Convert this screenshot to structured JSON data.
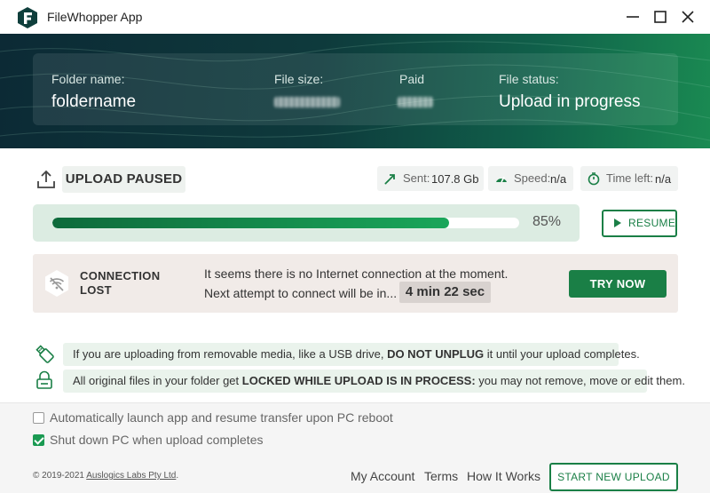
{
  "app": {
    "title": "FileWhopper App",
    "logo_letter": "F",
    "brand_color": "#1a7f46",
    "window_controls": [
      "minimize-icon",
      "maximize-icon",
      "close-icon"
    ]
  },
  "header": {
    "folder_label": "Folder name:",
    "folder_value": "foldername",
    "size_label": "File size:",
    "paid_label": "Paid",
    "status_label": "File status:",
    "status_value": "Upload in progress"
  },
  "status": {
    "icon": "upload-icon",
    "label": "UPLOAD PAUSED",
    "sent_label": "Sent:",
    "sent_value": "107.8 Gb",
    "speed_label": "Speed:",
    "speed_value": "n/a",
    "time_label": "Time left:",
    "time_value": "n/a"
  },
  "progress": {
    "percent": 85,
    "percent_text": "85%",
    "resume_label": "RESUME"
  },
  "connection": {
    "icon": "wifi-off-icon",
    "title_line1": "CONNECTION",
    "title_line2": "LOST",
    "message1": "It seems there is no Internet connection at the moment.",
    "message2": "Next attempt to connect will be in...",
    "countdown": "4 min 22 sec",
    "try_label": "TRY NOW"
  },
  "notices": [
    {
      "icon": "usb-drive-icon",
      "before": "If you are uploading from removable media, like a USB drive, ",
      "bold": "DO NOT UNPLUG",
      "after": " it until your upload completes."
    },
    {
      "icon": "lock-icon",
      "before": "All original files in your folder get ",
      "bold": "LOCKED WHILE UPLOAD IS IN PROCESS:",
      "after": " you may not remove, move or edit them."
    }
  ],
  "options": [
    {
      "label": "Automatically launch app and resume transfer upon PC reboot",
      "checked": false
    },
    {
      "label": "Shut down PC when upload completes",
      "checked": true
    }
  ],
  "footer": {
    "copyright_prefix": "© 2019-2021 ",
    "copyright_link": "Auslogics Labs Pty Ltd",
    "copyright_suffix": ".",
    "links": [
      "My Account",
      "Terms",
      "How It Works"
    ],
    "new_upload_label": "START NEW UPLOAD"
  }
}
